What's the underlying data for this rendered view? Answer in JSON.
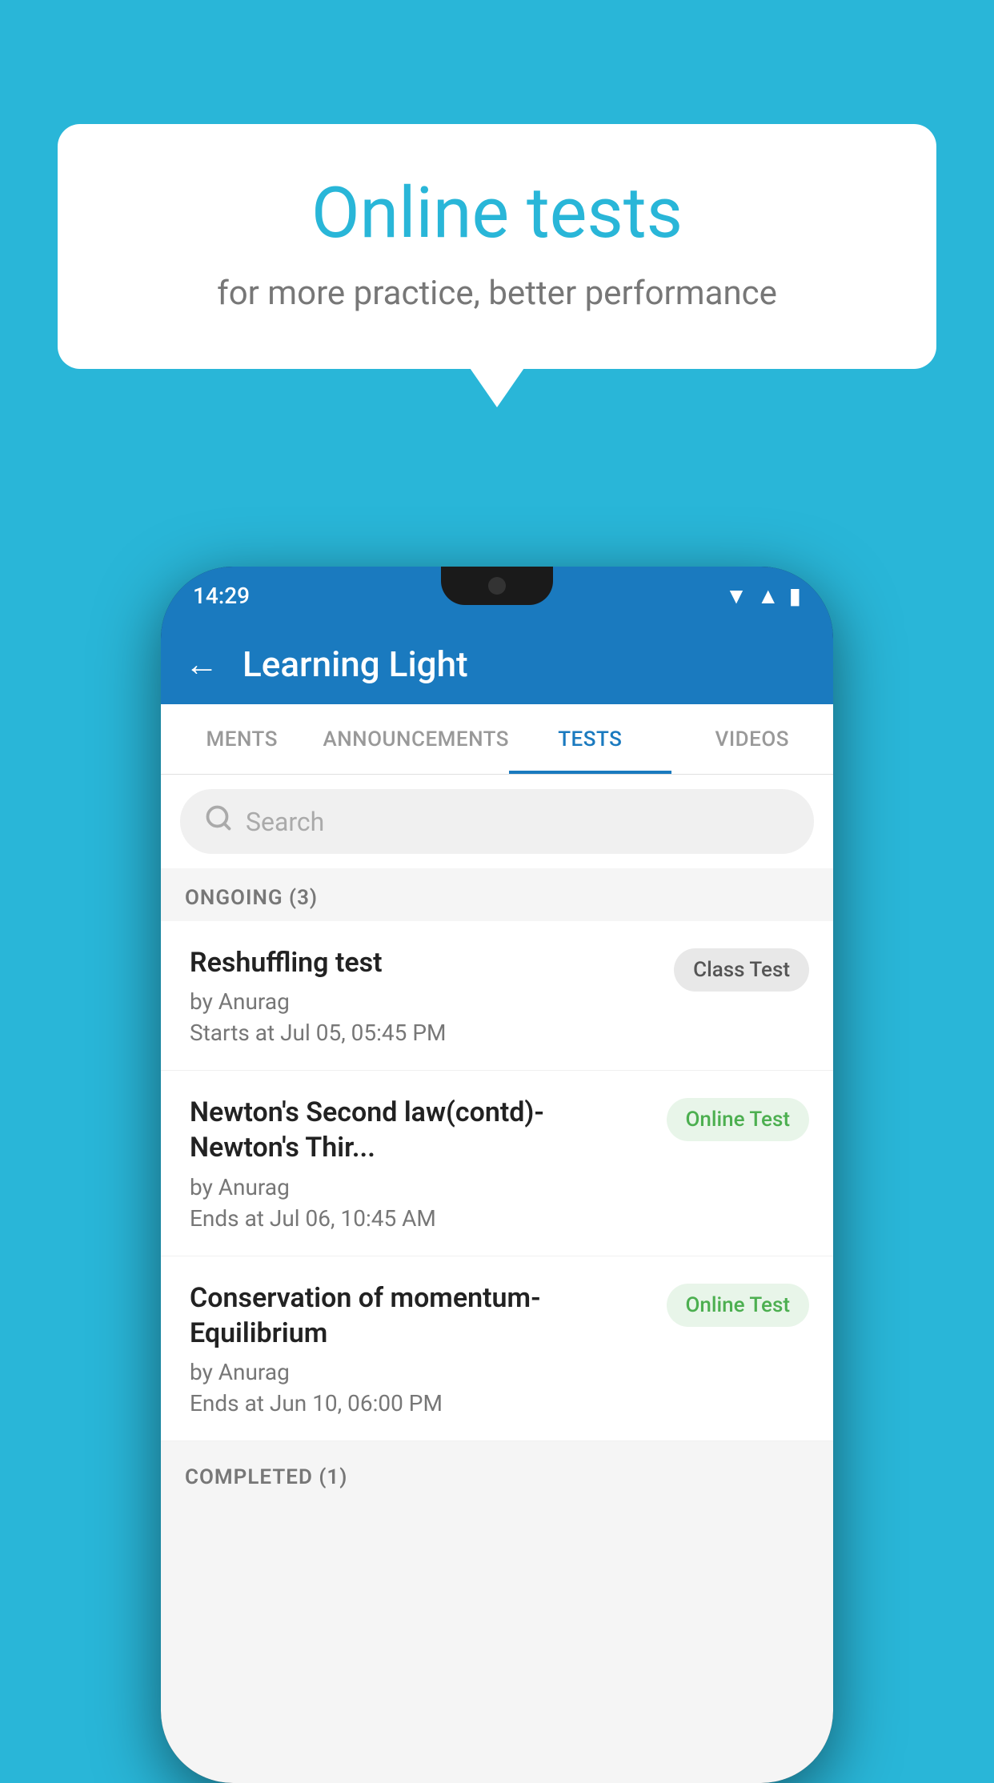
{
  "background_color": "#29B6D8",
  "bubble": {
    "title": "Online tests",
    "subtitle": "for more practice, better performance"
  },
  "phone": {
    "status_bar": {
      "time": "14:29",
      "icons": [
        "wifi",
        "signal",
        "battery"
      ]
    },
    "app_header": {
      "title": "Learning Light",
      "back_label": "←"
    },
    "tabs": [
      {
        "label": "MENTS",
        "active": false
      },
      {
        "label": "ANNOUNCEMENTS",
        "active": false
      },
      {
        "label": "TESTS",
        "active": true
      },
      {
        "label": "VIDEOS",
        "active": false
      }
    ],
    "search": {
      "placeholder": "Search"
    },
    "sections": [
      {
        "header": "ONGOING (3)",
        "items": [
          {
            "title": "Reshuffling test",
            "author": "by Anurag",
            "date": "Starts at  Jul 05, 05:45 PM",
            "badge": "Class Test",
            "badge_type": "class"
          },
          {
            "title": "Newton's Second law(contd)-Newton's Thir...",
            "author": "by Anurag",
            "date": "Ends at  Jul 06, 10:45 AM",
            "badge": "Online Test",
            "badge_type": "online"
          },
          {
            "title": "Conservation of momentum-Equilibrium",
            "author": "by Anurag",
            "date": "Ends at  Jun 10, 06:00 PM",
            "badge": "Online Test",
            "badge_type": "online"
          }
        ]
      }
    ],
    "completed_header": "COMPLETED (1)"
  }
}
